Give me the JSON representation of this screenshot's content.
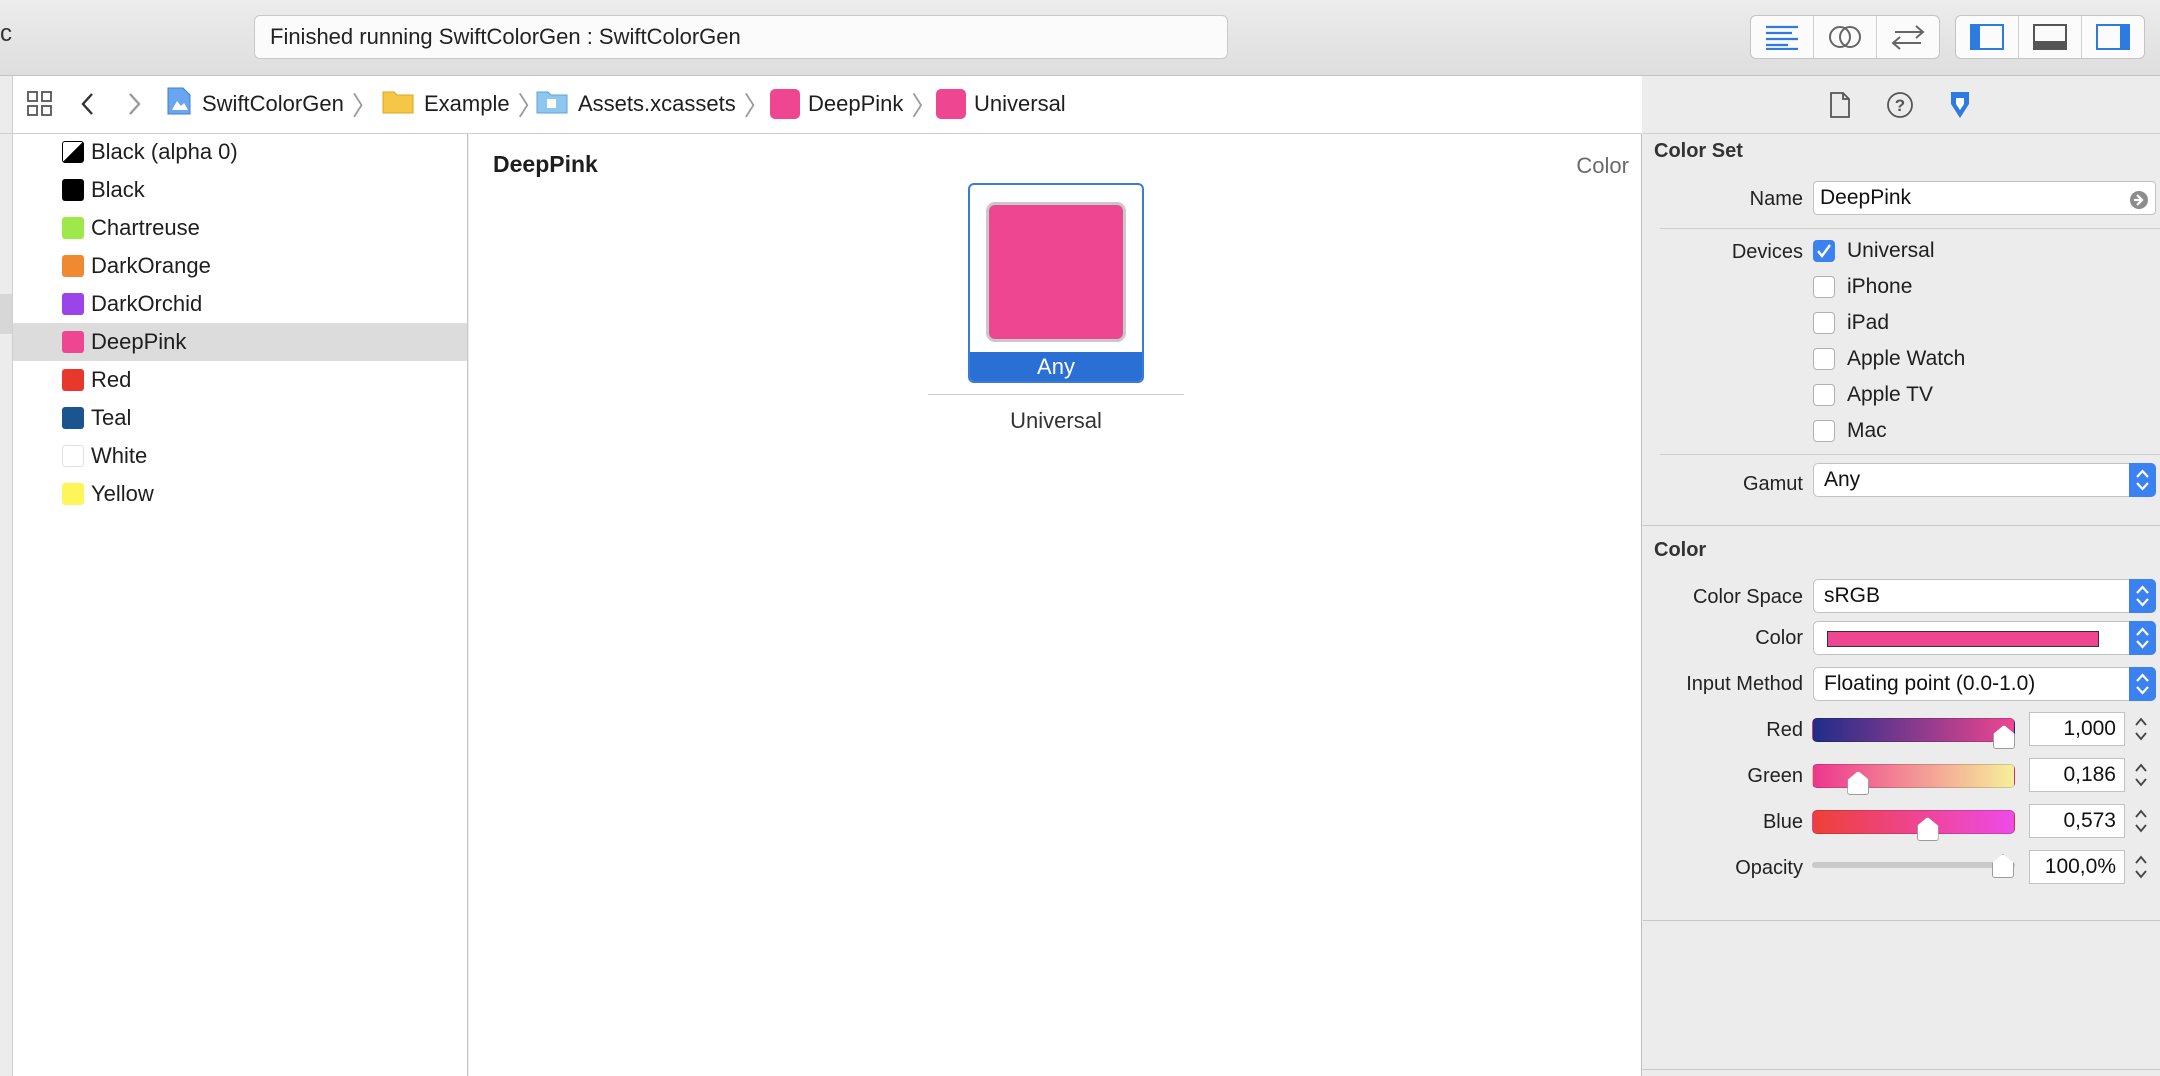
{
  "toolbar": {
    "left_cut_glyph": "c",
    "activity_text": "Finished running SwiftColorGen : SwiftColorGen",
    "editor_modes": [
      "standard-editor-icon",
      "assistant-editor-icon",
      "version-editor-icon"
    ],
    "panel_toggles": [
      "navigator-toggle-icon",
      "debug-area-toggle-icon",
      "utilities-toggle-icon"
    ]
  },
  "jumpbar": {
    "crumbs": [
      {
        "label": "SwiftColorGen",
        "icon": "project-icon"
      },
      {
        "label": "Example",
        "icon": "folder-icon"
      },
      {
        "label": "Assets.xcassets",
        "icon": "asset-catalog-icon"
      },
      {
        "label": "DeepPink",
        "icon": "color-set-icon"
      },
      {
        "label": "Universal",
        "icon": "color-set-icon"
      }
    ]
  },
  "sidebar": {
    "items": [
      {
        "label": "Black (alpha 0)",
        "color": "#000000",
        "alpha_zero": true
      },
      {
        "label": "Black",
        "color": "#000000"
      },
      {
        "label": "Chartreuse",
        "color": "#9ee84a"
      },
      {
        "label": "DarkOrange",
        "color": "#f08a32"
      },
      {
        "label": "DarkOrchid",
        "color": "#9a45e8"
      },
      {
        "label": "DeepPink",
        "color": "#ee4690",
        "selected": true
      },
      {
        "label": "Red",
        "color": "#e8382b"
      },
      {
        "label": "Teal",
        "color": "#1a5590"
      },
      {
        "label": "White",
        "color": "#ffffff"
      },
      {
        "label": "Yellow",
        "color": "#fdf55a"
      }
    ]
  },
  "canvas": {
    "title": "DeepPink",
    "type_label": "Color",
    "well_label": "Any",
    "caption": "Universal",
    "swatch_color": "#ee4690"
  },
  "inspector": {
    "tabs": [
      "file-inspector-icon",
      "quick-help-icon",
      "attributes-inspector-icon"
    ],
    "color_set": {
      "header": "Color Set",
      "name_label": "Name",
      "name_value": "DeepPink",
      "devices_label": "Devices",
      "devices": [
        {
          "label": "Universal",
          "checked": true
        },
        {
          "label": "iPhone",
          "checked": false
        },
        {
          "label": "iPad",
          "checked": false
        },
        {
          "label": "Apple Watch",
          "checked": false
        },
        {
          "label": "Apple TV",
          "checked": false
        },
        {
          "label": "Mac",
          "checked": false
        }
      ],
      "gamut_label": "Gamut",
      "gamut_value": "Any"
    },
    "color": {
      "header": "Color",
      "color_space_label": "Color Space",
      "color_space_value": "sRGB",
      "color_label": "Color",
      "color_value": "#ee4690",
      "input_method_label": "Input Method",
      "input_method_value": "Floating point (0.0-1.0)",
      "channels": [
        {
          "label": "Red",
          "value": "1,000",
          "level": 1.0
        },
        {
          "label": "Green",
          "value": "0,186",
          "level": 0.186
        },
        {
          "label": "Blue",
          "value": "0,573",
          "level": 0.573
        },
        {
          "label": "Opacity",
          "value": "100,0%",
          "level": 1.0
        }
      ]
    }
  },
  "colors": {
    "accent": "#3b82f0",
    "selection": "#2a6fd4",
    "deep_pink": "#ee4690"
  }
}
